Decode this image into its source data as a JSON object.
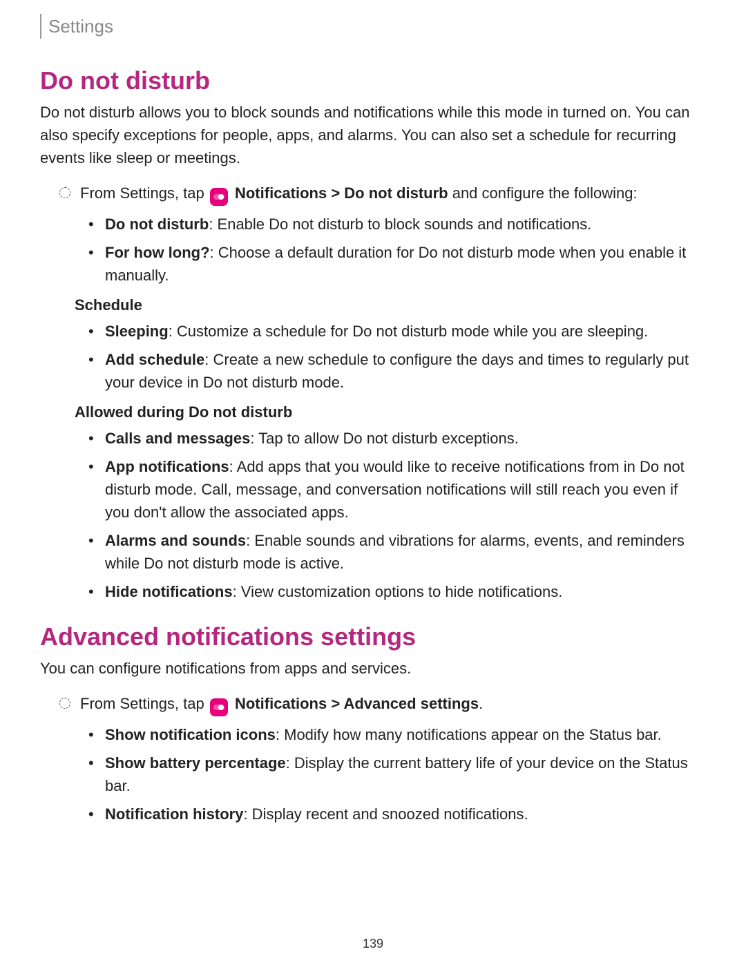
{
  "header": {
    "section_label": "Settings"
  },
  "sections": [
    {
      "title": "Do not disturb",
      "intro": "Do not disturb allows you to block sounds and notifications while this mode in turned on. You can also specify exceptions for people, apps, and alarms. You can also set a schedule for recurring events like sleep or meetings.",
      "step": {
        "prefix": "From Settings, tap ",
        "icon": "notifications-icon",
        "path_bold": "Notifications > Do not disturb",
        "suffix": " and configure the following:"
      },
      "groups": [
        {
          "subheading": null,
          "items": [
            {
              "label": "Do not disturb",
              "text": ": Enable Do not disturb to block sounds and notifications."
            },
            {
              "label": "For how long?",
              "text": ": Choose a default duration for Do not disturb mode when you enable it manually."
            }
          ]
        },
        {
          "subheading": "Schedule",
          "items": [
            {
              "label": "Sleeping",
              "text": ": Customize a schedule for Do not disturb mode while you are sleeping."
            },
            {
              "label": "Add schedule",
              "text": ": Create a new schedule to configure the days and times to regularly put your device in Do not disturb mode."
            }
          ]
        },
        {
          "subheading": "Allowed during Do not disturb",
          "items": [
            {
              "label": "Calls and messages",
              "text": ": Tap to allow Do not disturb exceptions."
            },
            {
              "label": "App notifications",
              "text": ": Add apps that you would like to receive notifications from in Do not disturb mode. Call, message, and conversation notifications will still reach you even if you don't allow the associated apps."
            },
            {
              "label": "Alarms and sounds",
              "text": ": Enable sounds and vibrations for alarms, events, and reminders while Do not disturb mode is active."
            },
            {
              "label": "Hide notifications",
              "text": ": View customization options to hide notifications."
            }
          ]
        }
      ]
    },
    {
      "title": "Advanced notifications settings",
      "intro": "You can configure notifications from apps and services.",
      "step": {
        "prefix": "From Settings, tap ",
        "icon": "notifications-icon",
        "path_bold": "Notifications > Advanced settings",
        "suffix": "."
      },
      "groups": [
        {
          "subheading": null,
          "items": [
            {
              "label": "Show notification icons",
              "text": ": Modify how many notifications appear on the Status bar."
            },
            {
              "label": "Show battery percentage",
              "text": ": Display the current battery life of your device on the Status bar."
            },
            {
              "label": "Notification history",
              "text": ": Display recent and snoozed notifications."
            }
          ]
        }
      ]
    }
  ],
  "footer": {
    "page_number": "139"
  }
}
